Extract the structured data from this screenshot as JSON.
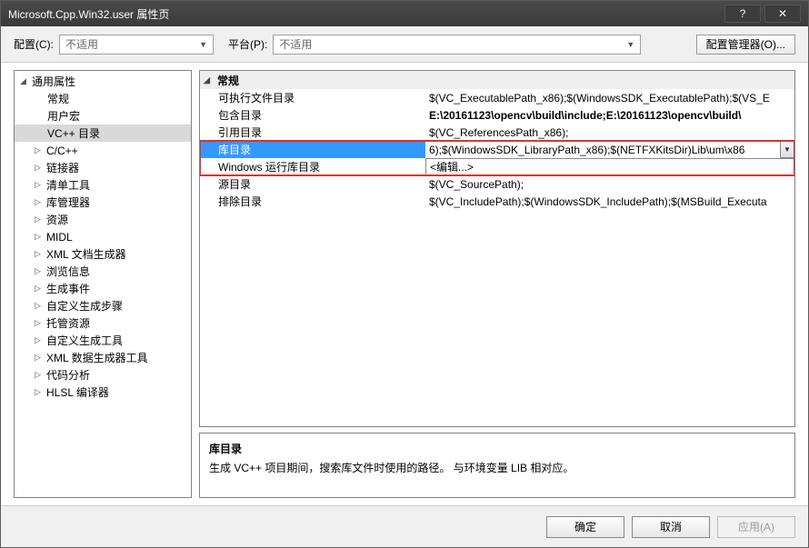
{
  "window": {
    "title": "Microsoft.Cpp.Win32.user 属性页"
  },
  "config_row": {
    "config_label": "配置(C):",
    "config_value": "不适用",
    "platform_label": "平台(P):",
    "platform_value": "不适用",
    "manager_btn": "配置管理器(O)..."
  },
  "tree": {
    "root": "通用属性",
    "items": [
      {
        "label": "常规",
        "exp": false,
        "noexp": true
      },
      {
        "label": "用户宏",
        "exp": false,
        "noexp": true
      },
      {
        "label": "VC++ 目录",
        "exp": false,
        "noexp": true,
        "selected": true
      },
      {
        "label": "C/C++",
        "exp": true
      },
      {
        "label": "链接器",
        "exp": true
      },
      {
        "label": "清单工具",
        "exp": true
      },
      {
        "label": "库管理器",
        "exp": true
      },
      {
        "label": "资源",
        "exp": true
      },
      {
        "label": "MIDL",
        "exp": true
      },
      {
        "label": "XML 文档生成器",
        "exp": true
      },
      {
        "label": "浏览信息",
        "exp": true
      },
      {
        "label": "生成事件",
        "exp": true
      },
      {
        "label": "自定义生成步骤",
        "exp": true
      },
      {
        "label": "托管资源",
        "exp": true
      },
      {
        "label": "自定义生成工具",
        "exp": true
      },
      {
        "label": "XML 数据生成器工具",
        "exp": true
      },
      {
        "label": "代码分析",
        "exp": true
      },
      {
        "label": "HLSL 编译器",
        "exp": true
      }
    ]
  },
  "grid": {
    "group": "常规",
    "rows": [
      {
        "label": "可执行文件目录",
        "value": "$(VC_ExecutablePath_x86);$(WindowsSDK_ExecutablePath);$(VS_E"
      },
      {
        "label": "包含目录",
        "value": "E:\\20161123\\opencv\\build\\include;E:\\20161123\\opencv\\build\\",
        "bold": true
      },
      {
        "label": "引用目录",
        "value": "$(VC_ReferencesPath_x86);"
      },
      {
        "label": "库目录",
        "value": "6);$(WindowsSDK_LibraryPath_x86);$(NETFXKitsDir)Lib\\um\\x86",
        "selected": true,
        "highlight": true
      },
      {
        "label": "Windows 运行库目录",
        "value": "<编辑...>",
        "editing": true
      },
      {
        "label": "源目录",
        "value": "$(VC_SourcePath);"
      },
      {
        "label": "排除目录",
        "value": "$(VC_IncludePath);$(WindowsSDK_IncludePath);$(MSBuild_Executa"
      }
    ]
  },
  "description": {
    "title": "库目录",
    "text": "生成 VC++ 项目期间，搜索库文件时使用的路径。    与环境变量 LIB 相对应。"
  },
  "buttons": {
    "ok": "确定",
    "cancel": "取消",
    "apply": "应用(A)"
  }
}
